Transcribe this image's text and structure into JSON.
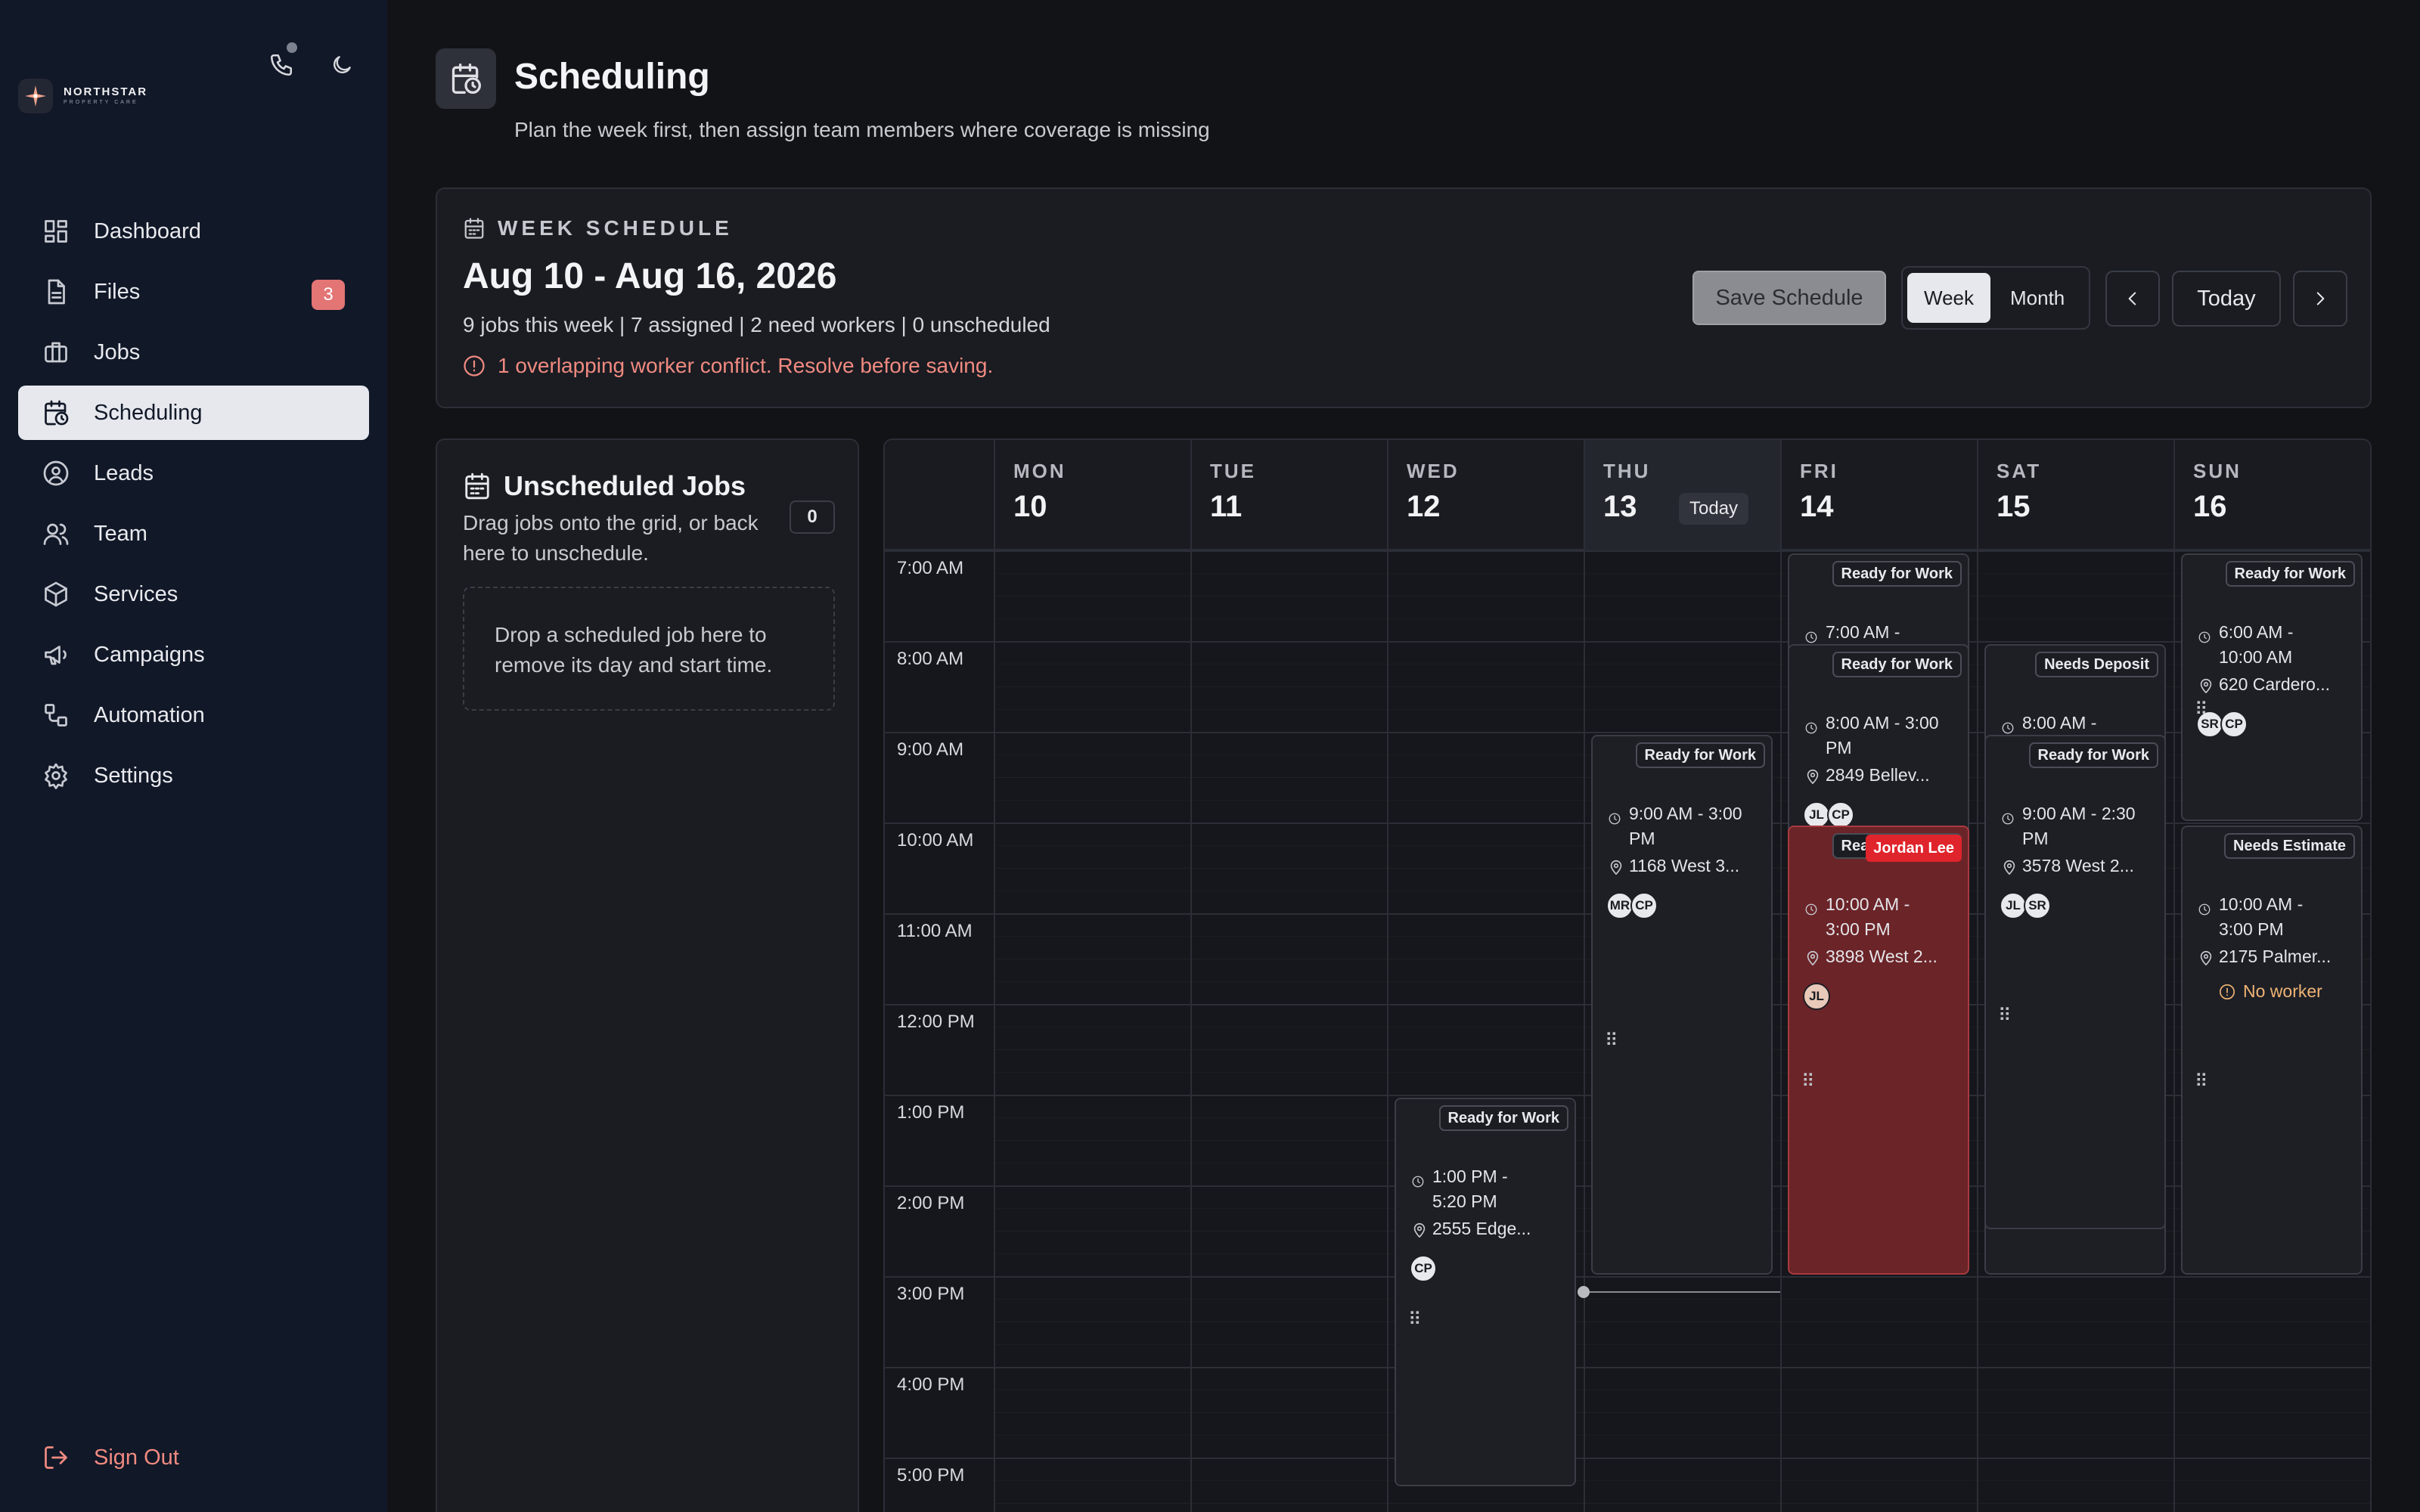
{
  "brand": {
    "name": "NORTHSTAR",
    "sub": "PROPERTY CARE"
  },
  "top_icons": [
    "phone-icon",
    "moon-icon"
  ],
  "nav": [
    {
      "label": "Dashboard",
      "icon": "dashboard-icon"
    },
    {
      "label": "Files",
      "icon": "file-icon",
      "badge": "3"
    },
    {
      "label": "Jobs",
      "icon": "briefcase-icon"
    },
    {
      "label": "Scheduling",
      "icon": "calendar-clock-icon",
      "active": true
    },
    {
      "label": "Leads",
      "icon": "user-circle-icon"
    },
    {
      "label": "Team",
      "icon": "users-icon"
    },
    {
      "label": "Services",
      "icon": "box-icon"
    },
    {
      "label": "Campaigns",
      "icon": "megaphone-icon"
    },
    {
      "label": "Automation",
      "icon": "workflow-icon"
    },
    {
      "label": "Settings",
      "icon": "gear-icon"
    }
  ],
  "signout": "Sign Out",
  "page": {
    "title": "Scheduling",
    "subtitle": "Plan the week first, then assign team members where coverage is missing"
  },
  "week": {
    "label": "WEEK SCHEDULE",
    "range": "Aug 10 - Aug 16, 2026",
    "stats": "9 jobs this week | 7 assigned | 2 need workers | 0 unscheduled",
    "conflict": "1 overlapping worker conflict. Resolve before saving.",
    "save": "Save Schedule",
    "views": [
      "Week",
      "Month"
    ],
    "active_view": "Week",
    "today": "Today"
  },
  "unscheduled": {
    "title": "Unscheduled Jobs",
    "count": "0",
    "description": "Drag jobs onto the grid, or back here to unschedule.",
    "drop_text": "Drop a scheduled job here to remove its day and start time."
  },
  "calendar": {
    "today_label": "Today",
    "days": [
      {
        "name": "MON",
        "num": "10"
      },
      {
        "name": "TUE",
        "num": "11"
      },
      {
        "name": "WED",
        "num": "12"
      },
      {
        "name": "THU",
        "num": "13",
        "today": true
      },
      {
        "name": "FRI",
        "num": "14"
      },
      {
        "name": "SAT",
        "num": "15"
      },
      {
        "name": "SUN",
        "num": "16"
      }
    ],
    "hours": [
      "7:00 AM",
      "8:00 AM",
      "9:00 AM",
      "10:00 AM",
      "11:00 AM",
      "12:00 PM",
      "1:00 PM",
      "2:00 PM",
      "3:00 PM",
      "4:00 PM",
      "5:00 PM"
    ],
    "events": [
      {
        "day": 2,
        "start": 13.0,
        "end": 17.33,
        "status": "Ready for Work",
        "time": "1:00 PM - 5:20 PM",
        "location": "2555 Edge...",
        "workers": [
          "CP"
        ]
      },
      {
        "day": 3,
        "start": 9.0,
        "end": 15.0,
        "status": "Ready for Work",
        "time": "9:00 AM - 3:00 PM",
        "location": "1168 West 3...",
        "workers": [
          "MR",
          "CP"
        ]
      },
      {
        "day": 4,
        "start": 7.0,
        "end": 15.0,
        "status": "Ready for Work",
        "time": "7:00 AM -",
        "location": "",
        "workers": []
      },
      {
        "day": 4,
        "start": 8.0,
        "end": 15.0,
        "status": "Ready for Work",
        "time": "8:00 AM - 3:00 PM",
        "location": "2849 Bellev...",
        "workers": [
          "JL",
          "CP"
        ]
      },
      {
        "day": 4,
        "start": 10.0,
        "end": 15.0,
        "status": "Ready for Work",
        "time": "10:00 AM - 3:00 PM",
        "location": "3898 West 2...",
        "workers": [
          "JL"
        ],
        "conflict": "Jordan Lee"
      },
      {
        "day": 5,
        "start": 8.0,
        "end": 15.0,
        "status": "Needs Deposit",
        "time": "8:00 AM -",
        "location": "",
        "workers": []
      },
      {
        "day": 5,
        "start": 9.0,
        "end": 14.5,
        "status": "Ready for Work",
        "time": "9:00 AM - 2:30 PM",
        "location": "3578 West 2...",
        "workers": [
          "JL",
          "SR"
        ]
      },
      {
        "day": 6,
        "start": 7.0,
        "end": 10.0,
        "status": "Ready for Work",
        "time": "6:00 AM - 10:00 AM",
        "location": "620 Cardero...",
        "workers": [
          "SR",
          "CP"
        ]
      },
      {
        "day": 6,
        "start": 10.0,
        "end": 15.0,
        "status": "Needs Estimate",
        "time": "10:00 AM - 3:00 PM",
        "location": "2175 Palmer...",
        "workers": [],
        "no_worker": "No worker"
      }
    ]
  }
}
